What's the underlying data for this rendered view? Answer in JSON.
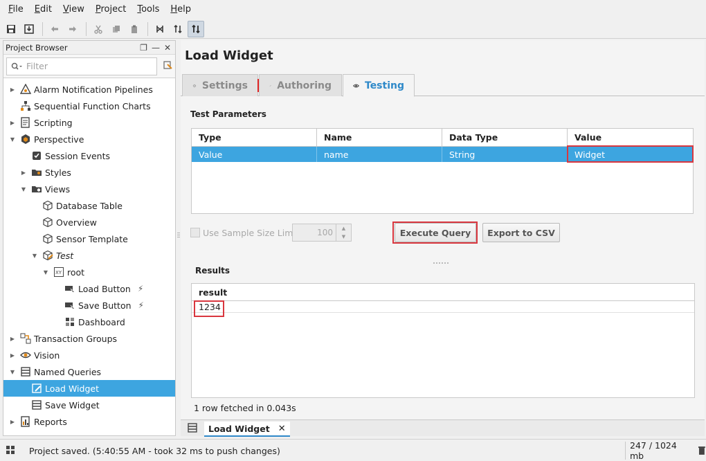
{
  "menubar": {
    "items": [
      {
        "mnemonic": "F",
        "rest": "ile"
      },
      {
        "mnemonic": "E",
        "rest": "dit"
      },
      {
        "mnemonic": "V",
        "rest": "iew"
      },
      {
        "mnemonic": "P",
        "rest": "roject"
      },
      {
        "mnemonic": "T",
        "rest": "ools"
      },
      {
        "mnemonic": "H",
        "rest": "elp"
      }
    ]
  },
  "toolbar": {
    "icons": [
      "save-icon",
      "save-all-icon",
      "undo-icon",
      "redo-icon",
      "cut-icon",
      "copy-icon",
      "paste-icon",
      "tool-a-icon",
      "tool-b-icon",
      "comm-toggle-icon"
    ]
  },
  "project_browser": {
    "title": "Project Browser",
    "filter_placeholder": "Filter",
    "tree": [
      {
        "label": "Alarm Notification Pipelines",
        "icon": "alarm-pipeline-icon",
        "expander": "collapsed"
      },
      {
        "label": "Sequential Function Charts",
        "icon": "sfc-icon",
        "expander": "none"
      },
      {
        "label": "Scripting",
        "icon": "scripting-icon",
        "expander": "collapsed"
      },
      {
        "label": "Perspective",
        "icon": "perspective-icon",
        "expander": "expanded"
      },
      {
        "label": "Session Events",
        "icon": "session-events-icon",
        "expander": "none"
      },
      {
        "label": "Styles",
        "icon": "folder-icon",
        "expander": "collapsed"
      },
      {
        "label": "Views",
        "icon": "views-folder-icon",
        "expander": "expanded"
      },
      {
        "label": "Database Table",
        "icon": "view-cube-icon",
        "expander": "none"
      },
      {
        "label": "Overview",
        "icon": "view-cube-icon",
        "expander": "none"
      },
      {
        "label": "Sensor Template",
        "icon": "view-cube-icon",
        "expander": "none"
      },
      {
        "label": "Test",
        "icon": "view-cube-edit-icon",
        "expander": "expanded"
      },
      {
        "label": "root",
        "icon": "xy-container-icon",
        "expander": "expanded"
      },
      {
        "label": "Load Button",
        "icon": "button-component-icon",
        "expander": "none",
        "bolt": "⚡"
      },
      {
        "label": "Save Button",
        "icon": "button-component-icon",
        "expander": "none",
        "bolt": "⚡"
      },
      {
        "label": "Dashboard",
        "icon": "dashboard-component-icon",
        "expander": "none"
      },
      {
        "label": "Transaction Groups",
        "icon": "transaction-groups-icon",
        "expander": "collapsed"
      },
      {
        "label": "Vision",
        "icon": "vision-icon",
        "expander": "collapsed"
      },
      {
        "label": "Named Queries",
        "icon": "named-queries-icon",
        "expander": "expanded"
      },
      {
        "label": "Load Widget",
        "icon": "named-query-edit-icon",
        "expander": "none",
        "selected": true
      },
      {
        "label": "Save Widget",
        "icon": "named-query-icon",
        "expander": "none"
      },
      {
        "label": "Reports",
        "icon": "reports-icon",
        "expander": "collapsed"
      }
    ]
  },
  "editor": {
    "title": "Load Widget",
    "tabs": [
      {
        "label": "Settings",
        "icon": "gear-icon"
      },
      {
        "label": "Authoring",
        "icon": "pencil-icon"
      },
      {
        "label": "Testing",
        "icon": "eye-icon",
        "active": true
      }
    ],
    "test_parameters": {
      "label": "Test Parameters",
      "columns": [
        "Type",
        "Name",
        "Data Type",
        "Value"
      ],
      "rows": [
        [
          "Value",
          "name",
          "String",
          "Widget"
        ]
      ]
    },
    "sample_size": {
      "checkbox_label": "Use Sample Size Limit",
      "value": "100"
    },
    "execute_button": "Execute Query",
    "export_button": "Export to CSV",
    "results": {
      "label": "Results",
      "column": "result",
      "rows": [
        "1234"
      ]
    },
    "fetched_text": "1 row fetched in 0.043s",
    "bottom_tab": {
      "label": "Load Widget",
      "close": "✕"
    }
  },
  "statusbar": {
    "message": "Project saved. (5:40:55 AM - took 32 ms to push changes)",
    "memory": "247 / 1024 mb"
  },
  "colors": {
    "selection": "#3da5e0",
    "active_tab": "#2e89c9",
    "highlight": "#d9363e"
  }
}
